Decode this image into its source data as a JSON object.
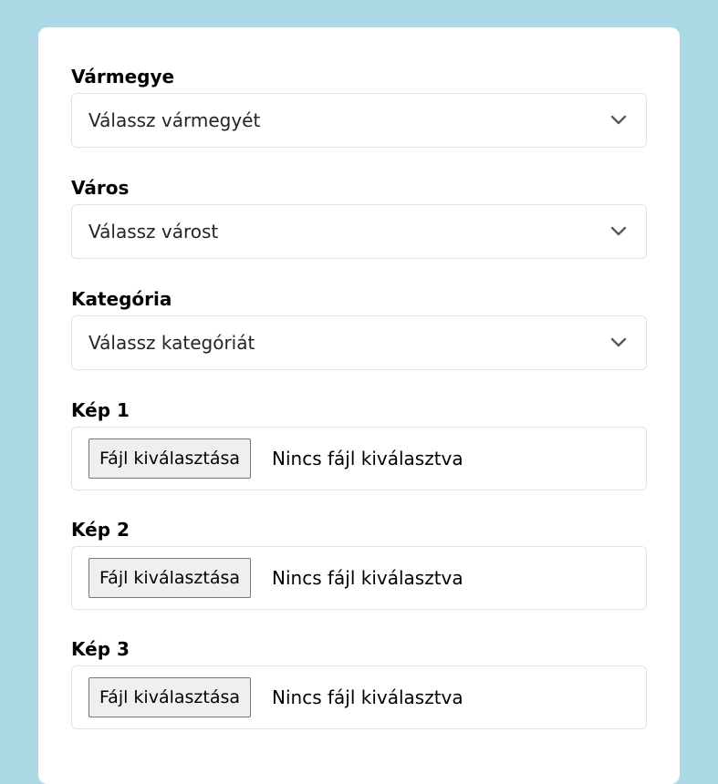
{
  "form": {
    "county": {
      "label": "Vármegye",
      "selected": "Válassz vármegyét"
    },
    "city": {
      "label": "Város",
      "selected": "Válassz várost"
    },
    "category": {
      "label": "Kategória",
      "selected": "Válassz kategóriát"
    },
    "images": [
      {
        "label": "Kép 1",
        "button": "Fájl kiválasztása",
        "status": "Nincs fájl kiválasztva"
      },
      {
        "label": "Kép 2",
        "button": "Fájl kiválasztása",
        "status": "Nincs fájl kiválasztva"
      },
      {
        "label": "Kép 3",
        "button": "Fájl kiválasztása",
        "status": "Nincs fájl kiválasztva"
      }
    ]
  },
  "icons": {
    "select_arrow": "chevron-down-icon"
  },
  "colors": {
    "page_background": "#add8e6",
    "card_background": "#ffffff",
    "border": "#dee2e6",
    "file_button_background": "#efefef"
  }
}
